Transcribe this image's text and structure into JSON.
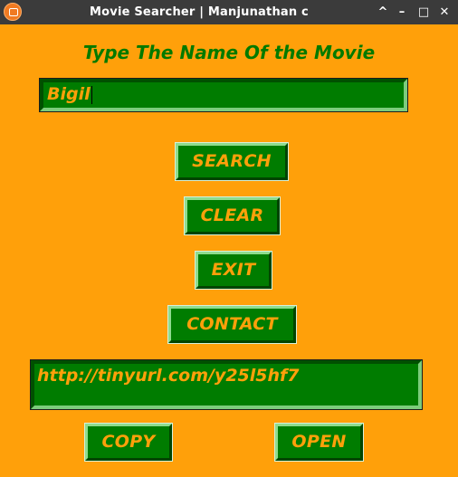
{
  "window": {
    "title": "Movie Searcher | Manjunathan c",
    "controls": [
      "^",
      "–",
      "□",
      "✕"
    ]
  },
  "heading": "Type The Name Of the Movie",
  "search_input": {
    "value": "Bigil"
  },
  "buttons": {
    "search": "SEARCH",
    "clear": "CLEAR",
    "exit": "EXIT",
    "contact": "CONTACT",
    "copy": "COPY",
    "open": "OPEN"
  },
  "result": {
    "url": "http://tinyurl.com/y25l5hf7"
  },
  "colors": {
    "background": "#ffa00a",
    "panel_green": "#007c00",
    "heading_green": "#007a00",
    "text_orange": "#ffa00a",
    "titlebar": "#3b3b3b"
  },
  "icons": [
    "app-icon",
    "chevron-up-icon",
    "minimize-icon",
    "maximize-icon",
    "close-icon"
  ]
}
